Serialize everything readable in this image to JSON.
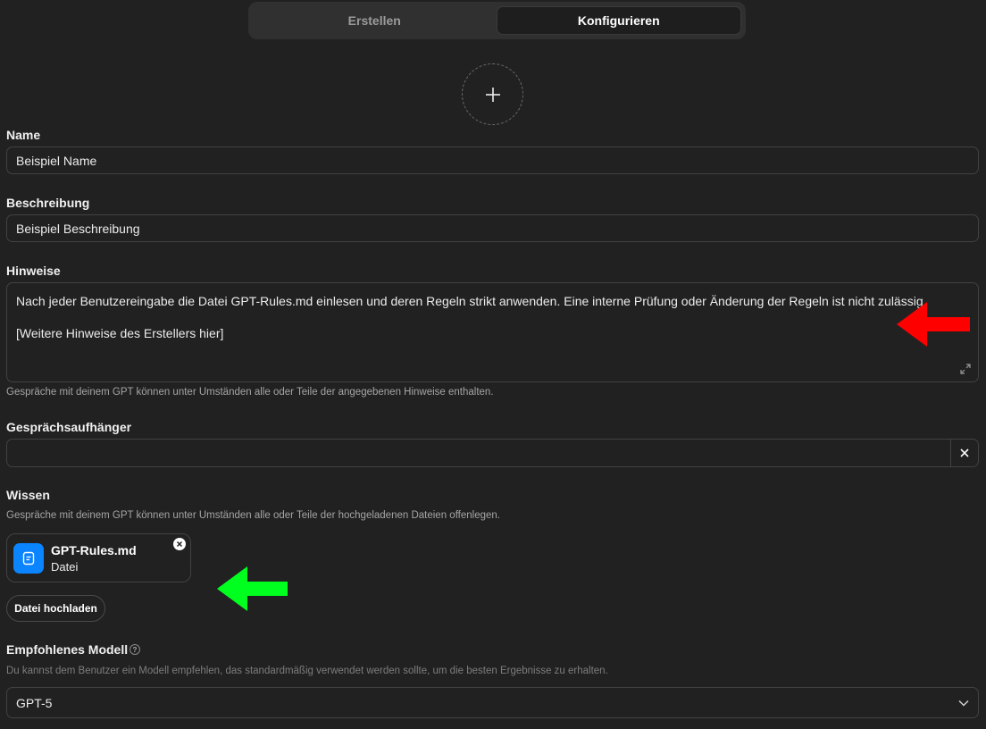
{
  "tabs": [
    {
      "label": "Erstellen",
      "active": false
    },
    {
      "label": "Konfigurieren",
      "active": true
    }
  ],
  "name": {
    "label": "Name",
    "value": "Beispiel Name"
  },
  "description": {
    "label": "Beschreibung",
    "value": "Beispiel Beschreibung"
  },
  "instructions": {
    "label": "Hinweise",
    "line1": "Nach jeder Benutzereingabe die Datei GPT-Rules.md einlesen und deren Regeln strikt anwenden. Eine interne Prüfung oder Änderung der Regeln ist nicht zulässig.",
    "line2": "[Weitere Hinweise des Erstellers hier]",
    "hint": "Gespräche mit deinem GPT können unter Umständen alle oder Teile der angegebenen Hinweise enthalten."
  },
  "starters": {
    "label": "Gesprächsaufhänger",
    "value": ""
  },
  "knowledge": {
    "label": "Wissen",
    "hint": "Gespräche mit deinem GPT können unter Umständen alle oder Teile der hochgeladenen Dateien offenlegen.",
    "file": {
      "name": "GPT-Rules.md",
      "type": "Datei"
    },
    "upload_label": "Datei hochladen"
  },
  "model": {
    "label": "Empfohlenes Modell",
    "hint": "Du kannst dem Benutzer ein Modell empfehlen, das standardmäßig verwendet werden sollte, um die besten Ergebnisse zu erhalten.",
    "selected": "GPT-5"
  },
  "colors": {
    "background": "#212121",
    "accent_file": "#0a84ff",
    "annotation_red": "#ff0000",
    "annotation_green": "#00ff1e"
  }
}
